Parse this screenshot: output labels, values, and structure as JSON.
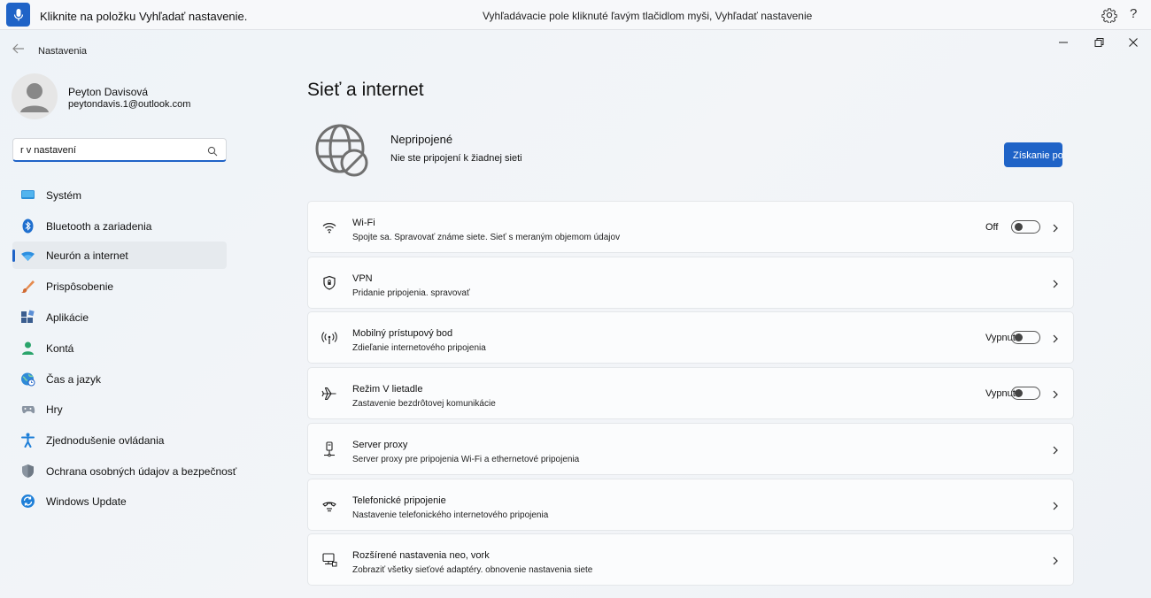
{
  "voice_bar": {
    "hint": "Kliknite na položku Vyhľadať nastavenie.",
    "status": "Vyhľadávacie pole kliknuté ľavým tlačidlom myši, Vyhľadať nastavenie",
    "help": "?"
  },
  "window": {
    "title": "Nastavenia"
  },
  "profile": {
    "name": "Peyton Davisová",
    "email": "peytondavis.1@outlook.com"
  },
  "search": {
    "value": "r v nastavení"
  },
  "nav": [
    {
      "label": "Systém",
      "icon": "monitor-icon"
    },
    {
      "label": "Bluetooth a zariadenia",
      "icon": "bluetooth-icon"
    },
    {
      "label": "Neurón a internet",
      "icon": "wifi-icon",
      "active": true
    },
    {
      "label": "Prispôsobenie",
      "icon": "brush-icon"
    },
    {
      "label": "Aplikácie",
      "icon": "apps-icon"
    },
    {
      "label": "Kontá",
      "icon": "person-icon"
    },
    {
      "label": "Čas a jazyk",
      "icon": "globe-clock-icon"
    },
    {
      "label": "Hry",
      "icon": "gamepad-icon"
    },
    {
      "label": "Zjednodušenie ovládania",
      "icon": "accessibility-icon"
    },
    {
      "label": "Ochrana osobných údajov a bezpečnosť",
      "icon": "shield-icon"
    },
    {
      "label": "Windows Update",
      "icon": "update-icon"
    }
  ],
  "main": {
    "title": "Sieť a internet",
    "status": {
      "title": "Nepripojené",
      "subtitle": "Nie ste pripojení k žiadnej sieti",
      "button": "Získanie pomoci"
    },
    "rows": [
      {
        "title": "Wi-Fi",
        "subtitle": "Spojte sa. Spravovať známe siete. Sieť s meraným objemom údajov",
        "icon": "wifi-icon",
        "state": "Off",
        "toggle": true
      },
      {
        "title": "VPN",
        "subtitle": "Pridanie pripojenia. spravovať",
        "icon": "vpn-shield-icon"
      },
      {
        "title": "Mobilný prístupový bod",
        "subtitle": "Zdieľanie internetového pripojenia",
        "icon": "hotspot-icon",
        "state": "Vypnuté",
        "toggle": true
      },
      {
        "title": "Režim V lietadle",
        "subtitle": "Zastavenie bezdrôtovej komunikácie",
        "icon": "airplane-icon",
        "state": "Vypnuté",
        "toggle": true
      },
      {
        "title": "Server proxy",
        "subtitle": "Server proxy pre pripojenia Wi-Fi a ethernetové pripojenia",
        "icon": "proxy-icon"
      },
      {
        "title": "Telefonické pripojenie",
        "subtitle": "Nastavenie telefonického internetového pripojenia",
        "icon": "dialup-icon"
      },
      {
        "title": "Rozšírené nastavenia neo, vork",
        "subtitle": "Zobraziť všetky sieťové adaptéry. obnovenie nastavenia siete",
        "icon": "computer-network-icon"
      }
    ]
  },
  "colors": {
    "accent": "#1f63c7"
  }
}
